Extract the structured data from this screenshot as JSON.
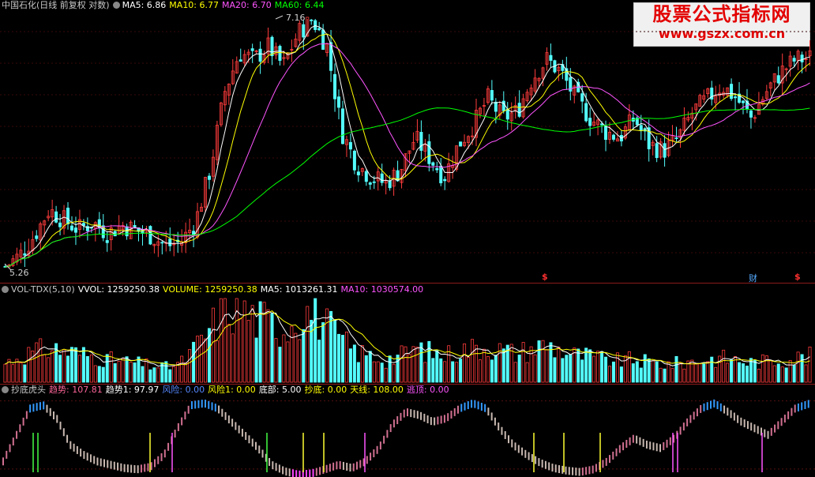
{
  "main_legend": {
    "title": "中国石化(日线 前复权 对数)",
    "ma5": "MA5: 6.86",
    "ma10": "MA10: 6.77",
    "ma20": "MA20: 6.70",
    "ma60": "MA60: 6.44"
  },
  "volume_legend": {
    "title": "VOL-TDX(5,10)",
    "vvol": "VVOL: 1259250.38",
    "volume": "VOLUME: 1259250.38",
    "ma5": "MA5: 1013261.31",
    "ma10": "MA10: 1030574.00"
  },
  "indicator_legend": {
    "title": "抄底虎头",
    "trend": "趋势: 107.81",
    "trend1": "趋势1: 97.97",
    "risk": "风险: 0.00",
    "risk1": "风险1: 0.00",
    "bottom": "底部: 5.00",
    "buy_bottom": "抄底: 0.00",
    "sky_line": "天线: 108.00",
    "escape_top": "逃顶: 0.00"
  },
  "watermark": {
    "title": "股票公式指标网",
    "url": "www.gszx.com.cn"
  },
  "price_annotations": {
    "high": "7.16",
    "low": "5.26"
  },
  "event_markers": [
    "$",
    "财",
    "$"
  ],
  "colors": {
    "up": "#ff3c3c",
    "down": "#54ffff",
    "ma5": "#ffffff",
    "ma10": "#ffff00",
    "ma20": "#ff55ff",
    "ma60": "#00ff00",
    "separator": "#8b1a1a"
  },
  "chart_data": [
    {
      "type": "candlestick",
      "title": "中国石化(日线 前复权 对数)",
      "series": [
        {
          "name": "MA5",
          "values": [
            6.86
          ]
        },
        {
          "name": "MA10",
          "values": [
            6.77
          ]
        },
        {
          "name": "MA20",
          "values": [
            6.7
          ]
        },
        {
          "name": "MA60",
          "values": [
            6.44
          ]
        }
      ],
      "range": {
        "low": 5.26,
        "high": 7.16
      },
      "close_path": [
        5.26,
        5.35,
        5.5,
        5.7,
        5.62,
        5.55,
        5.6,
        5.52,
        5.58,
        5.54,
        5.5,
        5.42,
        5.45,
        5.6,
        6.0,
        6.6,
        6.9,
        6.85,
        6.95,
        6.8,
        7.05,
        7.16,
        6.95,
        6.3,
        6.05,
        5.95,
        5.9,
        6.0,
        6.25,
        6.1,
        5.95,
        6.2,
        6.35,
        6.55,
        6.4,
        6.45,
        6.7,
        6.85,
        6.75,
        6.55,
        6.4,
        6.3,
        6.25,
        6.4,
        6.2,
        6.15,
        6.25,
        6.45,
        6.55,
        6.65,
        6.55,
        6.4,
        6.6,
        6.75,
        6.85,
        6.86
      ]
    },
    {
      "type": "bar",
      "title": "VOL-TDX(5,10)",
      "series": [
        {
          "name": "VOLUME",
          "values": [
            1259250.38
          ]
        },
        {
          "name": "MA5",
          "values": [
            1013261.31
          ]
        },
        {
          "name": "MA10",
          "values": [
            1030574.0
          ]
        }
      ],
      "volume_path": [
        0.25,
        0.35,
        0.4,
        0.45,
        0.42,
        0.38,
        0.35,
        0.3,
        0.28,
        0.25,
        0.22,
        0.2,
        0.25,
        0.45,
        0.7,
        0.95,
        1.0,
        0.85,
        0.8,
        0.7,
        0.9,
        0.95,
        0.75,
        0.55,
        0.4,
        0.35,
        0.3,
        0.35,
        0.45,
        0.4,
        0.35,
        0.42,
        0.45,
        0.48,
        0.42,
        0.38,
        0.45,
        0.5,
        0.42,
        0.36,
        0.34,
        0.3,
        0.28,
        0.3,
        0.26,
        0.24,
        0.25,
        0.28,
        0.3,
        0.32,
        0.3,
        0.26,
        0.28,
        0.3,
        0.32,
        0.34
      ]
    },
    {
      "type": "bar",
      "title": "抄底虎头",
      "series": [
        {
          "name": "趋势",
          "values": [
            107.81
          ]
        },
        {
          "name": "趋势1",
          "values": [
            97.97
          ]
        },
        {
          "name": "风险",
          "values": [
            0.0
          ]
        },
        {
          "name": "风险1",
          "values": [
            0.0
          ]
        },
        {
          "name": "底部",
          "values": [
            5.0
          ]
        },
        {
          "name": "抄底",
          "values": [
            0.0
          ]
        },
        {
          "name": "天线",
          "values": [
            108.0
          ]
        },
        {
          "name": "逃顶",
          "values": [
            0.0
          ]
        }
      ],
      "trend_path": [
        20,
        60,
        100,
        105,
        85,
        45,
        30,
        20,
        15,
        10,
        8,
        12,
        30,
        70,
        105,
        108,
        100,
        80,
        60,
        40,
        15,
        5,
        0,
        2,
        8,
        15,
        10,
        20,
        40,
        75,
        95,
        90,
        80,
        85,
        100,
        108,
        100,
        70,
        45,
        30,
        18,
        10,
        6,
        4,
        8,
        20,
        40,
        55,
        45,
        40,
        55,
        80,
        100,
        108,
        95,
        80,
        70,
        60,
        80,
        100,
        107
      ]
    }
  ]
}
